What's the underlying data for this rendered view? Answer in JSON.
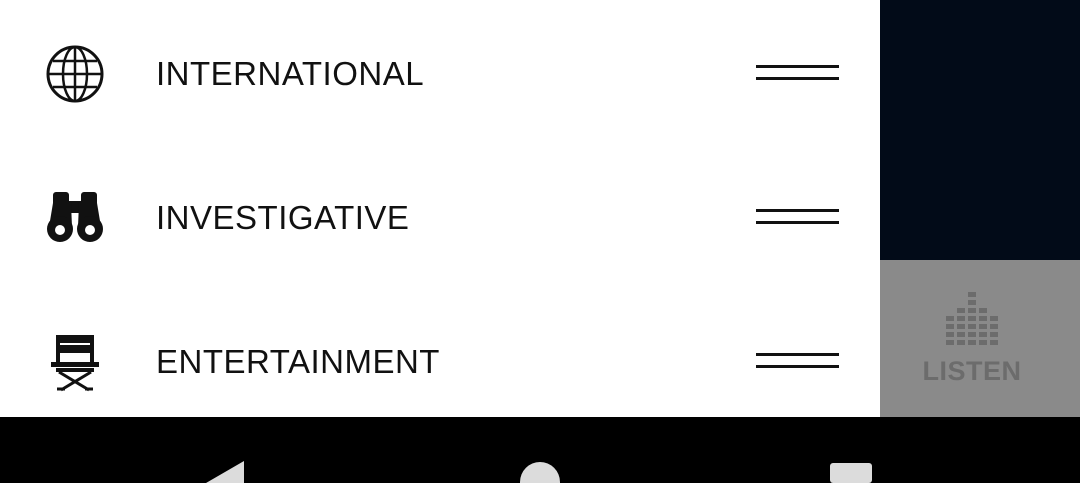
{
  "categories": [
    {
      "label": "INTERNATIONAL",
      "icon": "globe-icon",
      "handle_icon": "drag-handle-icon"
    },
    {
      "label": "INVESTIGATIVE",
      "icon": "binoculars-icon",
      "handle_icon": "drag-handle-icon"
    },
    {
      "label": "ENTERTAINMENT",
      "icon": "directors-chair-icon",
      "handle_icon": "drag-handle-icon"
    }
  ],
  "listen": {
    "label": "LISTEN",
    "icon": "equalizer-icon"
  },
  "nav_bar": {
    "back_icon": "back-icon",
    "home_icon": "home-icon",
    "recents_icon": "recents-icon"
  },
  "colors": {
    "drawer_background": "#ffffff",
    "text": "#111111",
    "right_panel": "#020b18",
    "listen_tile": "#8a8a8a",
    "listen_text": "#6c6c6c",
    "nav_bar": "#000000"
  }
}
